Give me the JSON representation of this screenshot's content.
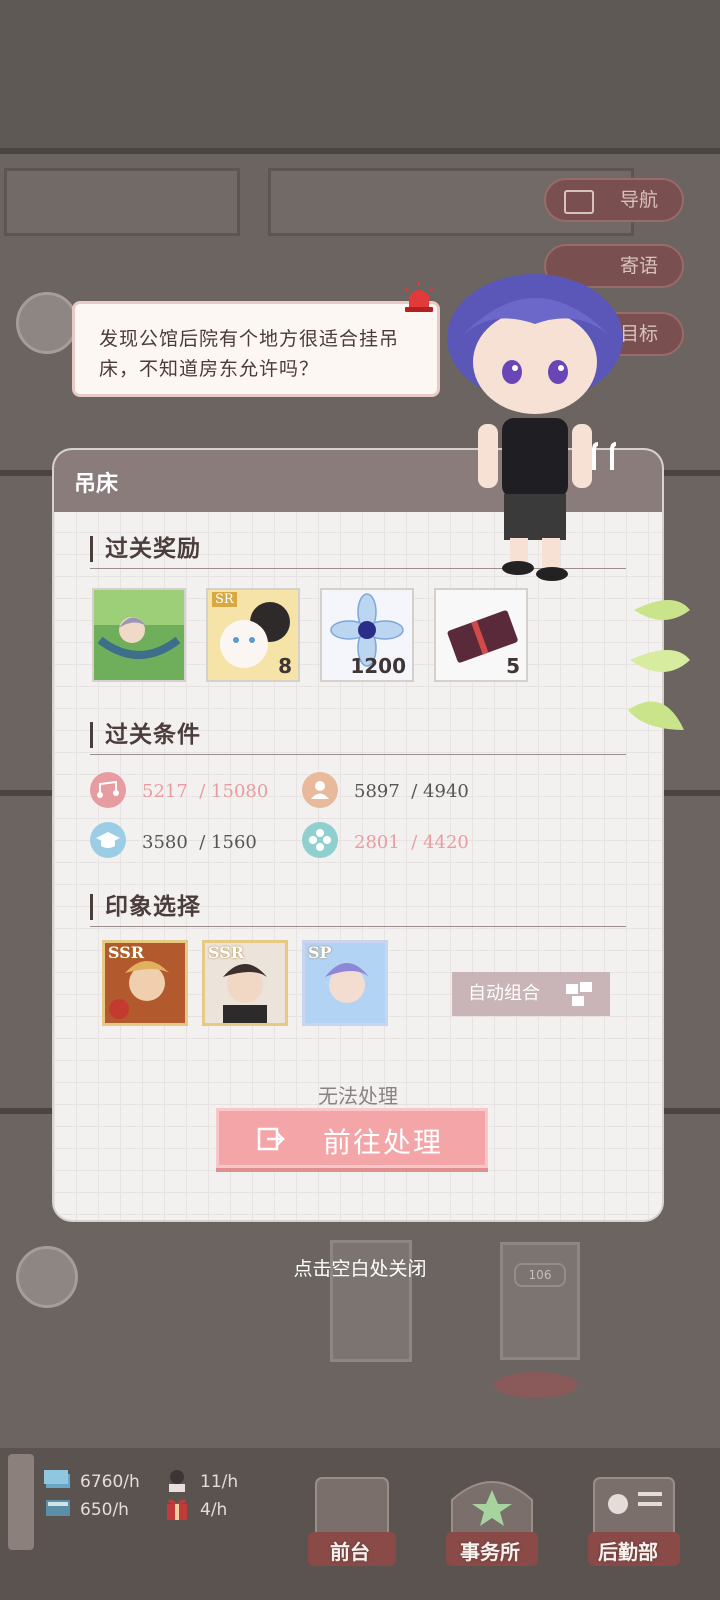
{
  "side_menu": {
    "navigate": "导航",
    "messages": "寄语",
    "goals": "目标"
  },
  "dialog": {
    "speech": "发现公馆后院有个地方很适合挂吊床，不知道房东允许吗？"
  },
  "panel": {
    "title": "吊床",
    "rewards_title": "过关奖励",
    "rewards": [
      {
        "name": "hammock-illustration",
        "count": ""
      },
      {
        "name": "sr-cats-card",
        "rank": "SR",
        "count": "8"
      },
      {
        "name": "crystal-flower",
        "count": "1200"
      },
      {
        "name": "ticket",
        "count": "5"
      }
    ],
    "conditions_title": "过关条件",
    "conditions": [
      {
        "icon": "music-note-icon",
        "current": "5217",
        "target": "/ 15080",
        "met": false,
        "color": "#e79ca2"
      },
      {
        "icon": "person-icon",
        "current": "5897",
        "target": "/ 4940",
        "met": true,
        "color": "#e8b99b"
      },
      {
        "icon": "graduation-cap-icon",
        "current": "3580",
        "target": "/ 1560",
        "met": true,
        "color": "#9ccde6"
      },
      {
        "icon": "flower-icon",
        "current": "2801",
        "target": "/ 4420",
        "met": false,
        "color": "#8fd0cf"
      }
    ],
    "impression_title": "印象选择",
    "impressions": [
      {
        "rank": "SSR"
      },
      {
        "rank": "SSR"
      },
      {
        "rank": "SP"
      }
    ],
    "auto_button": "自动组合",
    "status": "无法处理",
    "go_button": "前往处理"
  },
  "close_hint": "点击空白处关闭",
  "room_number": "106",
  "resources": {
    "income1": "6760/h",
    "income2": "650/h",
    "income3": "11/h",
    "income4": "4/h"
  },
  "bottom_nav": {
    "front_desk": "前台",
    "office": "事务所",
    "logistics": "后勤部"
  }
}
